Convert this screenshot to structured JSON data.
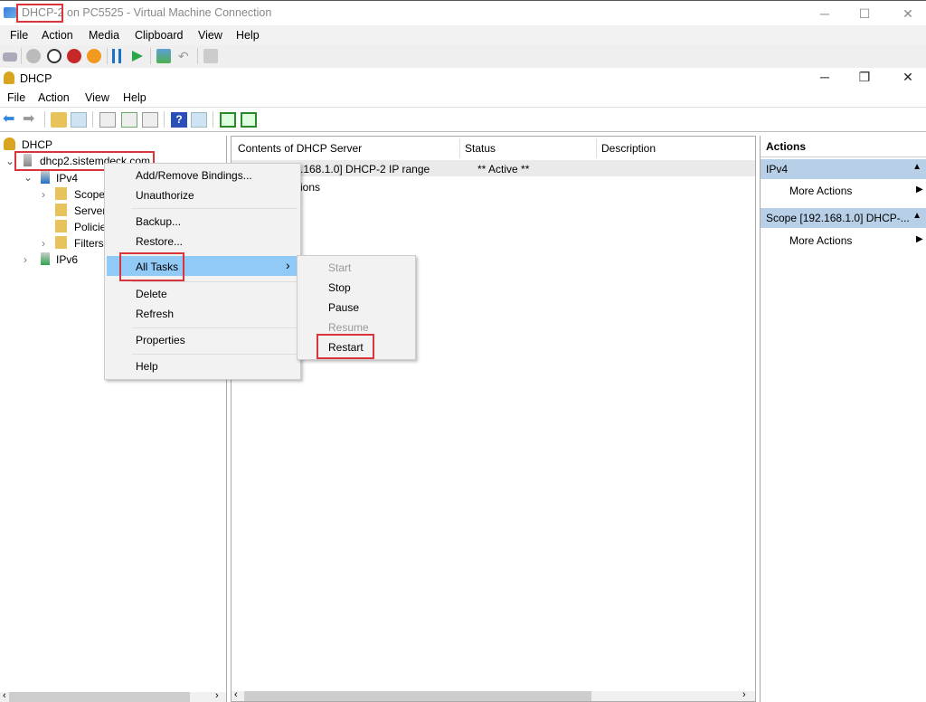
{
  "vm_window": {
    "title_highlight": "DHCP-2",
    "title_rest": " on PC5525 - Virtual Machine Connection",
    "menu": [
      "File",
      "Action",
      "Media",
      "Clipboard",
      "View",
      "Help"
    ],
    "controls": {
      "minimize": "─",
      "maximize": "☐",
      "close": "✕"
    }
  },
  "mmc_window": {
    "title": "DHCP",
    "menu": [
      "File",
      "Action",
      "View",
      "Help"
    ],
    "controls": {
      "minimize": "─",
      "restore": "❐",
      "close": "✕"
    }
  },
  "tree": {
    "root": "DHCP",
    "server": "dhcp2.sistemdeck.com",
    "items": [
      "IPv4",
      "Scope",
      "Server",
      "Policie",
      "Filters",
      "IPv6"
    ]
  },
  "list": {
    "columns": [
      "Contents of DHCP Server",
      "Status",
      "Description"
    ],
    "rows": [
      {
        "name": "Scope [192.168.1.0] DHCP-2 IP range",
        "name_visible": ".168.1.0] DHCP-2 IP range",
        "status": "** Active **",
        "description": ""
      },
      {
        "name": "Server Options",
        "name_visible": "ions",
        "status": "",
        "description": ""
      }
    ]
  },
  "actions": {
    "header": "Actions",
    "sections": [
      {
        "title": "IPv4",
        "item": "More Actions"
      },
      {
        "title": "Scope [192.168.1.0] DHCP-...",
        "item": "More Actions"
      }
    ]
  },
  "context_menu": {
    "items": [
      "Add/Remove Bindings...",
      "Unauthorize",
      "Backup...",
      "Restore...",
      "All Tasks",
      "Delete",
      "Refresh",
      "Properties",
      "Help"
    ],
    "submenu_arrow": "›"
  },
  "submenu": {
    "items": [
      {
        "label": "Start",
        "enabled": false
      },
      {
        "label": "Stop",
        "enabled": true
      },
      {
        "label": "Pause",
        "enabled": true
      },
      {
        "label": "Resume",
        "enabled": false
      },
      {
        "label": "Restart",
        "enabled": true
      }
    ]
  },
  "scroll_arrows": {
    "left": "‹",
    "right": "›"
  },
  "colors": {
    "highlight_red": "#d9353b",
    "selection_blue": "#91c9f7",
    "action_header": "#b7cfe7"
  }
}
